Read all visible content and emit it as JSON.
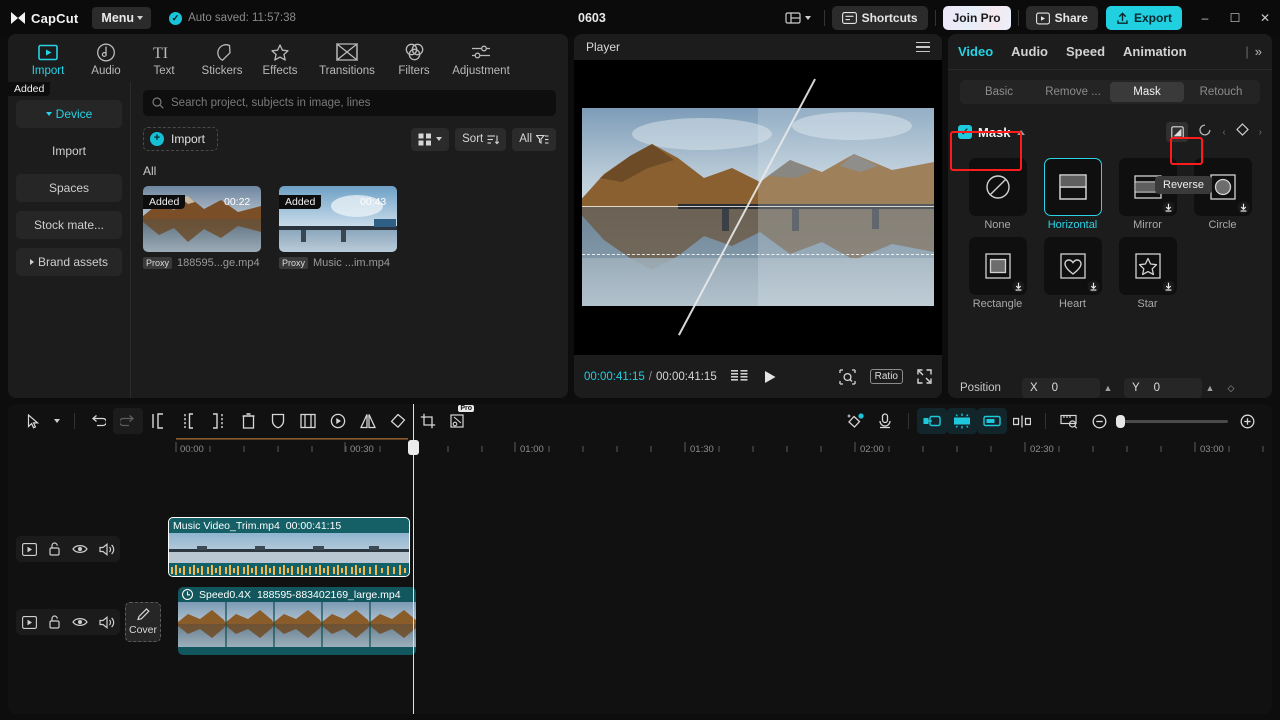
{
  "topbar": {
    "brand": "CapCut",
    "menu_label": "Menu",
    "autosave_text": "Auto saved: 11:57:38",
    "project_name": "0603",
    "layout_icon": "layout-icon",
    "shortcuts_label": "Shortcuts",
    "joinpro_label": "Join Pro",
    "share_label": "Share",
    "export_label": "Export",
    "minimize": "–",
    "maximize": "☐",
    "close": "✕"
  },
  "media_panel": {
    "tabs": [
      {
        "label": "Import",
        "icon": "import-icon",
        "active": true
      },
      {
        "label": "Audio",
        "icon": "audio-icon",
        "active": false
      },
      {
        "label": "Text",
        "icon": "text-icon",
        "active": false
      },
      {
        "label": "Stickers",
        "icon": "stickers-icon",
        "active": false
      },
      {
        "label": "Effects",
        "icon": "effects-icon",
        "active": false
      },
      {
        "label": "Transitions",
        "icon": "transitions-icon",
        "active": false
      },
      {
        "label": "Filters",
        "icon": "filters-icon",
        "active": false
      },
      {
        "label": "Adjustment",
        "icon": "adjustment-icon",
        "active": false
      }
    ],
    "side_nav": [
      {
        "label": "Device",
        "active": true
      },
      {
        "label": "Import",
        "active": false
      },
      {
        "label": "Spaces",
        "active": false
      },
      {
        "label": "Stock mate...",
        "active": false
      },
      {
        "label": "Brand assets",
        "active": false
      }
    ],
    "search_placeholder": "Search project, subjects in image, lines",
    "import_label": "Import",
    "grid_label": "",
    "sort_label": "Sort",
    "filter_label": "All",
    "section_label": "All",
    "items": [
      {
        "badge": "Added",
        "duration": "00:22",
        "proxy": "Proxy",
        "name": "188595...ge.mp4"
      },
      {
        "badge": "Added",
        "duration": "00:43",
        "proxy": "Proxy",
        "name": "Music ...im.mp4"
      }
    ]
  },
  "player": {
    "title": "Player",
    "current_time": "00:00:41:15",
    "separator": "/",
    "total_time": "00:00:41:15",
    "ratio_label": "Ratio",
    "icons": [
      "grid-icon",
      "play-icon",
      "magnifier-icon",
      "fullscreen-icon"
    ]
  },
  "right_panel": {
    "tabs": [
      {
        "label": "Video",
        "active": true
      },
      {
        "label": "Audio",
        "active": false
      },
      {
        "label": "Speed",
        "active": false
      },
      {
        "label": "Animation",
        "active": false
      }
    ],
    "more_icon": "chevron-double-right-icon",
    "segments": [
      {
        "label": "Basic",
        "active": false
      },
      {
        "label": "Remove ...",
        "active": false
      },
      {
        "label": "Mask",
        "active": true
      },
      {
        "label": "Retouch",
        "active": false
      }
    ],
    "mask_toggle_label": "Mask",
    "mask_toggle_checked": true,
    "reverse_tooltip": "Reverse",
    "reset_icon": "reset-icon",
    "keyframe_icon": "keyframe-diamond-icon",
    "shapes": [
      {
        "label": "None",
        "icon": "none-icon",
        "selected": false,
        "downloadable": false
      },
      {
        "label": "Horizontal",
        "icon": "horizontal-icon",
        "selected": true,
        "downloadable": false
      },
      {
        "label": "Mirror",
        "icon": "mirror-icon",
        "selected": false,
        "downloadable": true
      },
      {
        "label": "Circle",
        "icon": "circle-icon",
        "selected": false,
        "downloadable": true
      },
      {
        "label": "Rectangle",
        "icon": "rectangle-icon",
        "selected": false,
        "downloadable": true
      },
      {
        "label": "Heart",
        "icon": "heart-icon",
        "selected": false,
        "downloadable": true
      },
      {
        "label": "Star",
        "icon": "star-icon",
        "selected": false,
        "downloadable": true
      }
    ],
    "position": {
      "label": "Position",
      "x_label": "X",
      "x_value": "0",
      "y_label": "Y",
      "y_value": "0"
    },
    "highlight_color": "#fe1b1b",
    "accent_color": "#25d3e6"
  },
  "timeline": {
    "tools": [
      "select-arrow-icon",
      "chevron-down-icon",
      "undo-icon",
      "redo-icon",
      "split-left-icon",
      "split-icon",
      "split-right-icon",
      "delete-icon",
      "shield-icon",
      "freeze-frame-icon",
      "speed-icon",
      "mirror-flip-icon",
      "rotate-icon",
      "crop-icon",
      "smart-cut-pro-icon"
    ],
    "pro_badge": "Pro",
    "right_tools": [
      "magic-wand-icon",
      "mic-icon",
      "keyframe-left-icon",
      "auto-cut-icon",
      "keyframe-right-icon",
      "marker-icon",
      "measure-icon",
      "zoom-out-icon",
      "zoom-in-icon"
    ],
    "ruler_ticks": [
      "00:00",
      "00:30",
      "01:00",
      "01:30",
      "02:00",
      "02:30",
      "03:00"
    ],
    "cover_label": "Cover",
    "clips": [
      {
        "name": "Music Video_Trim.mp4",
        "duration": "00:00:41:15",
        "selected": true,
        "type": "video-audio"
      },
      {
        "name": "188595-883402169_large.mp4",
        "speed": "Speed0.4X",
        "selected": false,
        "type": "video"
      }
    ],
    "track_controls": [
      "track-thumb-icon",
      "lock-icon",
      "eye-icon",
      "volume-icon"
    ]
  }
}
